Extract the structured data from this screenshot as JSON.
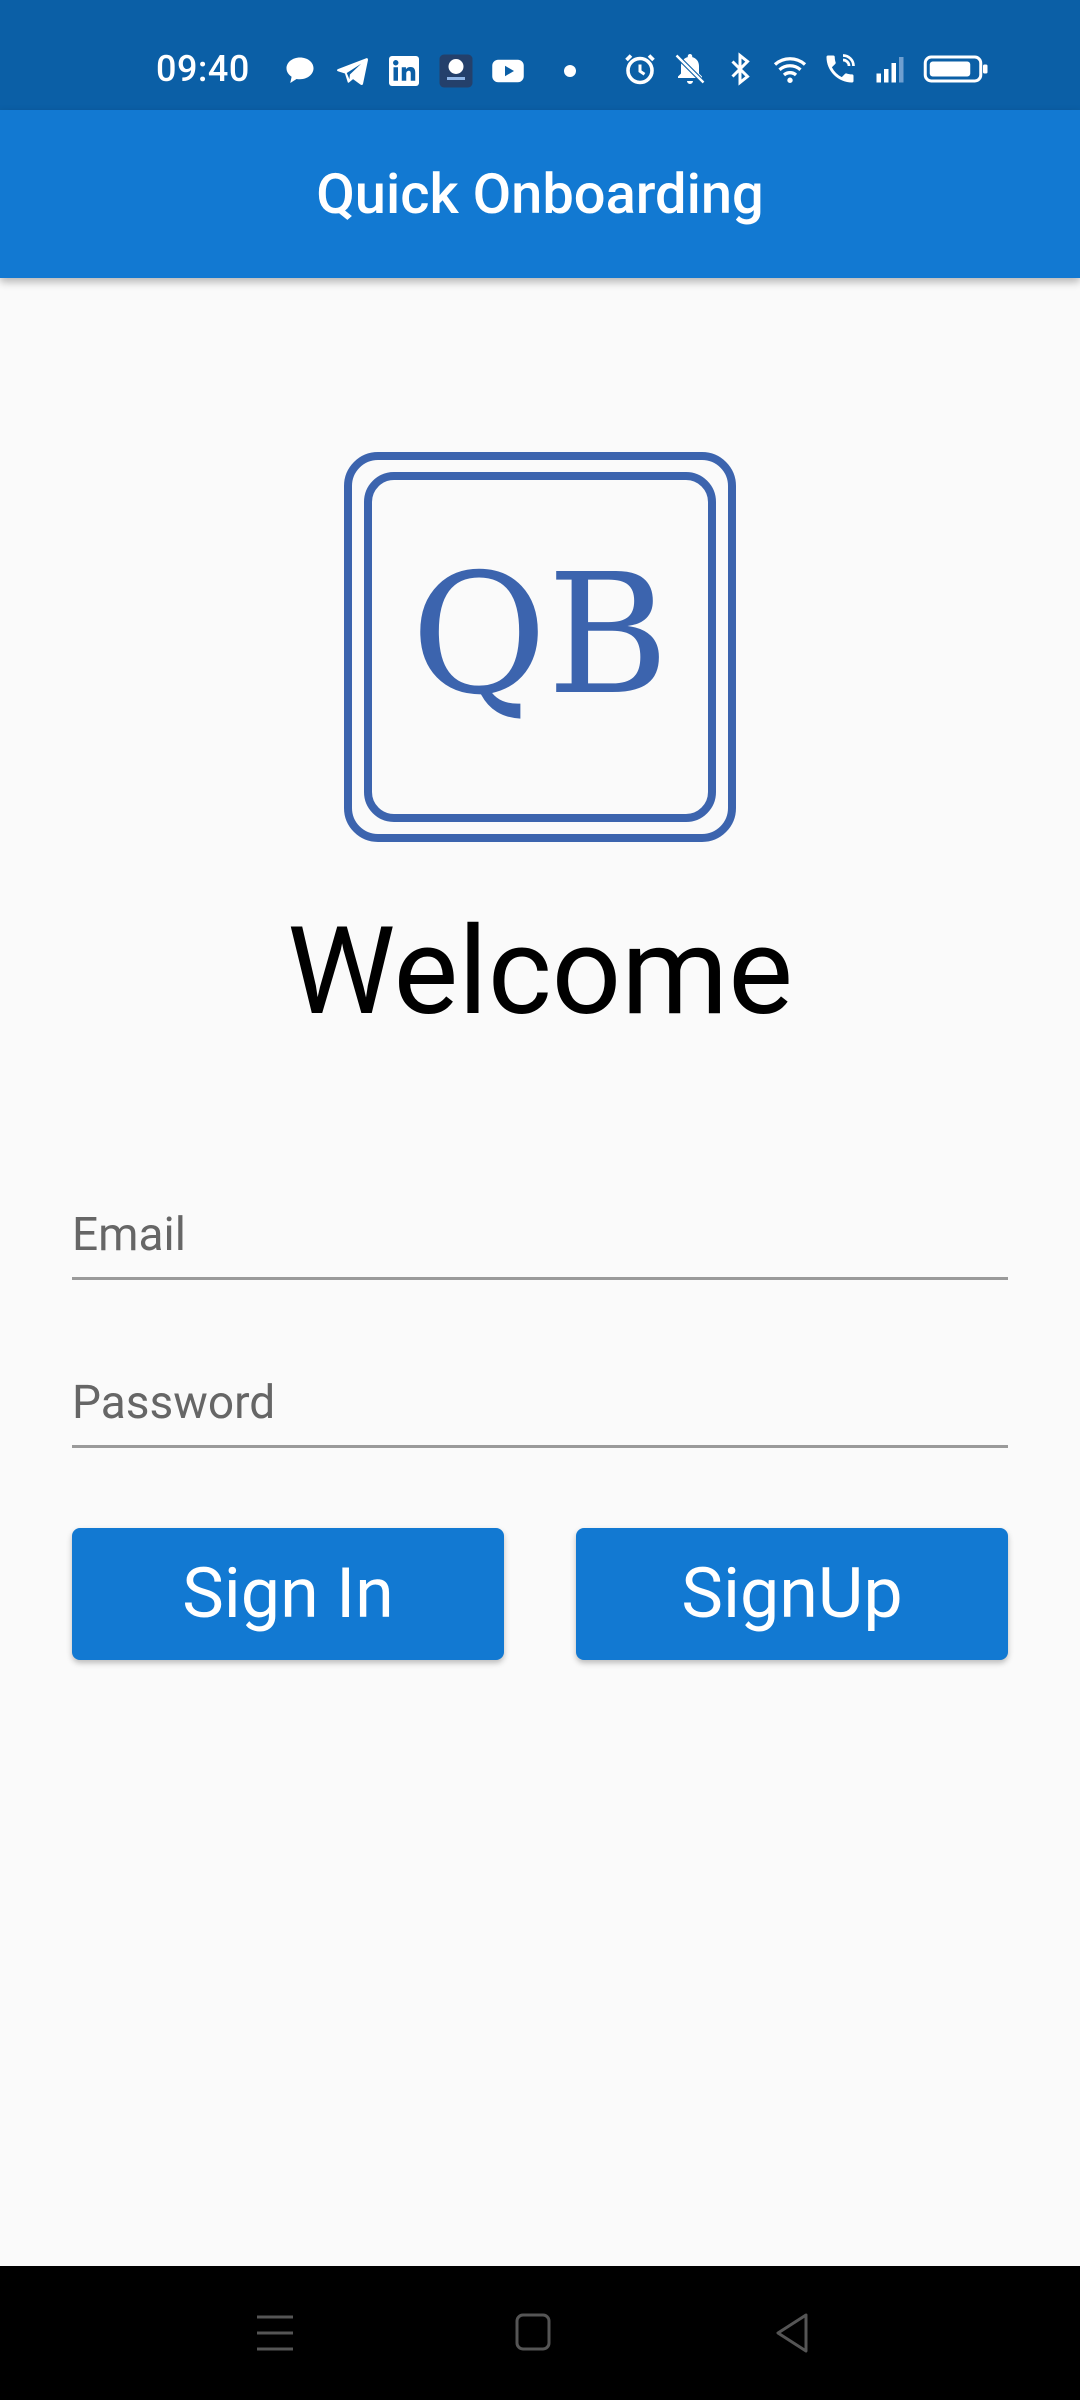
{
  "status_bar": {
    "time": "09:40",
    "left_icons": [
      "chat-bubble-icon",
      "telegram-icon",
      "linkedin-icon",
      "app-badge-icon",
      "youtube-icon"
    ],
    "right_icons": [
      "alarm-icon",
      "bell-muted-icon",
      "bluetooth-icon",
      "wifi-icon",
      "wifi-call-icon",
      "signal-icon",
      "battery-icon"
    ]
  },
  "app_bar": {
    "title": "Quick Onboarding"
  },
  "logo": {
    "text": "QB"
  },
  "welcome_text": "Welcome",
  "form": {
    "email_placeholder": "Email",
    "email_value": "",
    "password_placeholder": "Password",
    "password_value": ""
  },
  "buttons": {
    "sign_in": "Sign In",
    "sign_up": "SignUp"
  },
  "nav_bar": {
    "icons": [
      "menu-icon",
      "home-icon",
      "back-icon"
    ]
  },
  "colors": {
    "status_bar": "#0b5fa6",
    "primary": "#1279d2",
    "logo": "#3c64ae",
    "background": "#fafafa"
  }
}
